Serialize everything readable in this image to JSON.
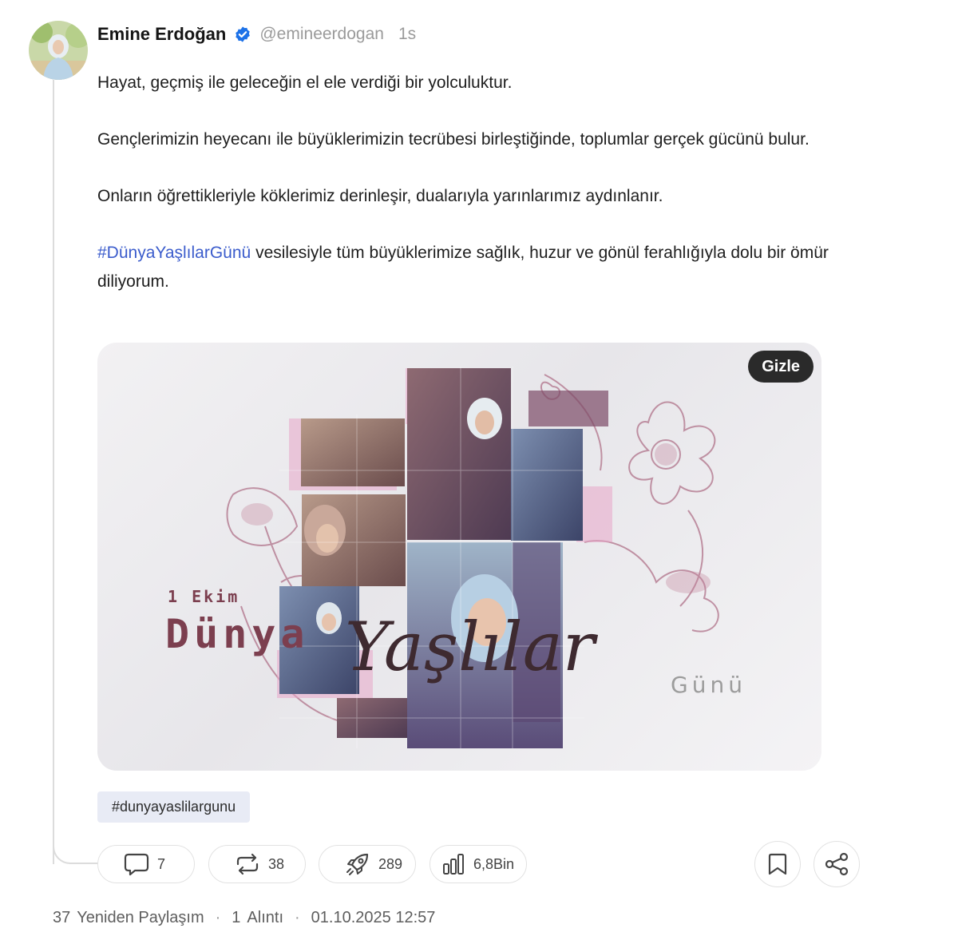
{
  "author": {
    "name": "Emine Erdoğan",
    "handle": "@emineerdogan",
    "time_ago": "1s"
  },
  "post": {
    "paragraphs": [
      "Hayat, geçmiş ile geleceğin el ele verdiği bir yolculuktur.",
      "Gençlerimizin heyecanı ile büyüklerimizin tecrübesi birleştiğinde, toplumlar gerçek gücünü bulur.",
      "Onların öğrettikleriyle köklerimiz derinleşir, dualarıyla yarınlarımız aydınlanır."
    ],
    "hashtag": "#DünyaYaşlılarGünü",
    "closing": " vesilesiyle tüm büyüklerimize sağlık, huzur ve gönül ferahlığıyla dolu bir ömür diliyorum."
  },
  "media": {
    "hide_label": "Gizle",
    "poster": {
      "date": "1 Ekim",
      "word1": "Dünya",
      "word2": "Yaşlılar",
      "word3": "Günü"
    }
  },
  "tag_chip": "#dunyayaslilargunu",
  "actions": {
    "comments": "7",
    "reposts": "38",
    "boosts": "289",
    "views": "6,8Bin"
  },
  "icons": [
    "verified-badge-icon",
    "comment-icon",
    "repost-icon",
    "rocket-icon",
    "views-chart-icon",
    "bookmark-icon",
    "share-icon"
  ],
  "footer": {
    "reposts_count": "37",
    "reposts_label": "Yeniden Paylaşım",
    "quotes_count": "1",
    "quotes_label": "Alıntı",
    "timestamp": "01.10.2025 12:57"
  },
  "colors": {
    "link": "#3b5ccc",
    "verified": "#1d72e8",
    "poster_title": "#7c3f4f",
    "poster_accent": "#c46b91"
  }
}
